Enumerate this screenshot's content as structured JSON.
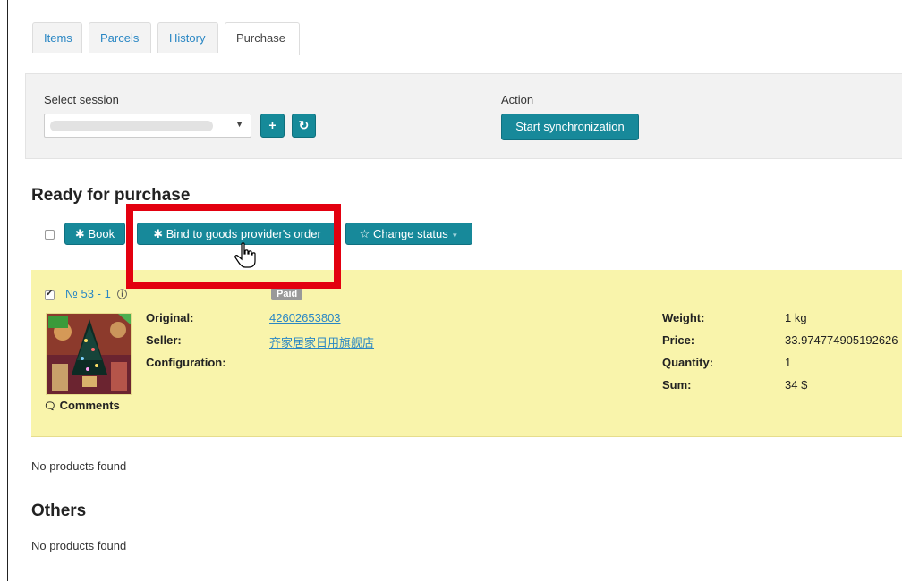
{
  "tabs": [
    {
      "label": "Items",
      "active": false
    },
    {
      "label": "Parcels",
      "active": false
    },
    {
      "label": "History",
      "active": false
    },
    {
      "label": "Purchase",
      "active": true
    }
  ],
  "session": {
    "label": "Select session",
    "action_label": "Action",
    "sync_button": "Start synchronization",
    "add_symbol": "+",
    "refresh_symbol": "↻"
  },
  "ready": {
    "title": "Ready for purchase",
    "book_label": "Book",
    "bind_label": "Bind to goods provider's order",
    "change_status_label": "Change status",
    "item": {
      "number": "№ 53 - 1",
      "status": "Paid",
      "original_key": "Original:",
      "original_value": "42602653803",
      "seller_key": "Seller:",
      "seller_value": "齐家居家日用旗舰店",
      "config_key": "Configuration:",
      "comments": "Comments",
      "weight_key": "Weight:",
      "weight_value": "1 kg",
      "price_key": "Price:",
      "price_value": "33.974774905192626",
      "quantity_key": "Quantity:",
      "quantity_value": "1",
      "sum_key": "Sum:",
      "sum_value": "34 $"
    },
    "empty": "No products found"
  },
  "others": {
    "title": "Others",
    "empty": "No products found"
  },
  "colors": {
    "accent": "#17899a",
    "highlight": "#e3000f",
    "item_bg": "#f9f4ab"
  }
}
